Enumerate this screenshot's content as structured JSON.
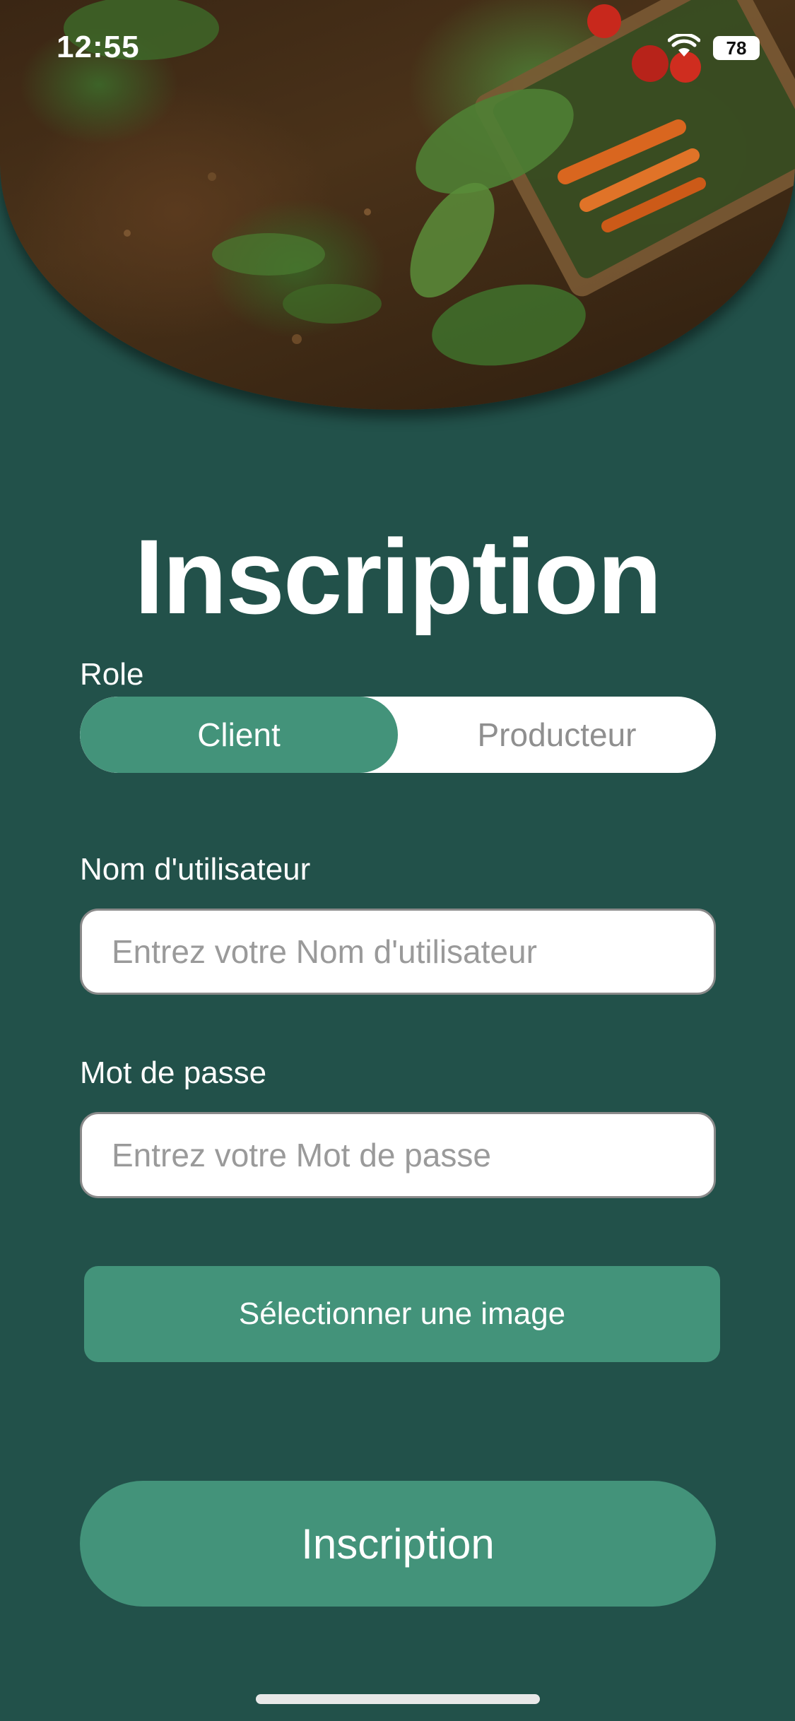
{
  "status_bar": {
    "time": "12:55",
    "battery": "78",
    "icons": [
      "wifi-icon",
      "battery-icon"
    ]
  },
  "header": {
    "title": "Inscription"
  },
  "role": {
    "label": "Role",
    "options": [
      "Client",
      "Producteur"
    ],
    "selected": "Client"
  },
  "username": {
    "label": "Nom d'utilisateur",
    "placeholder": "Entrez votre Nom d'utilisateur",
    "value": ""
  },
  "password": {
    "label": "Mot de passe",
    "placeholder": "Entrez votre Mot de passe",
    "value": ""
  },
  "image_button": {
    "label": "Sélectionner une image"
  },
  "submit_button": {
    "label": "Inscription"
  },
  "colors": {
    "background": "#22514a",
    "accent": "#43937a",
    "field": "#ffffff",
    "placeholder": "#9a9a9a"
  }
}
